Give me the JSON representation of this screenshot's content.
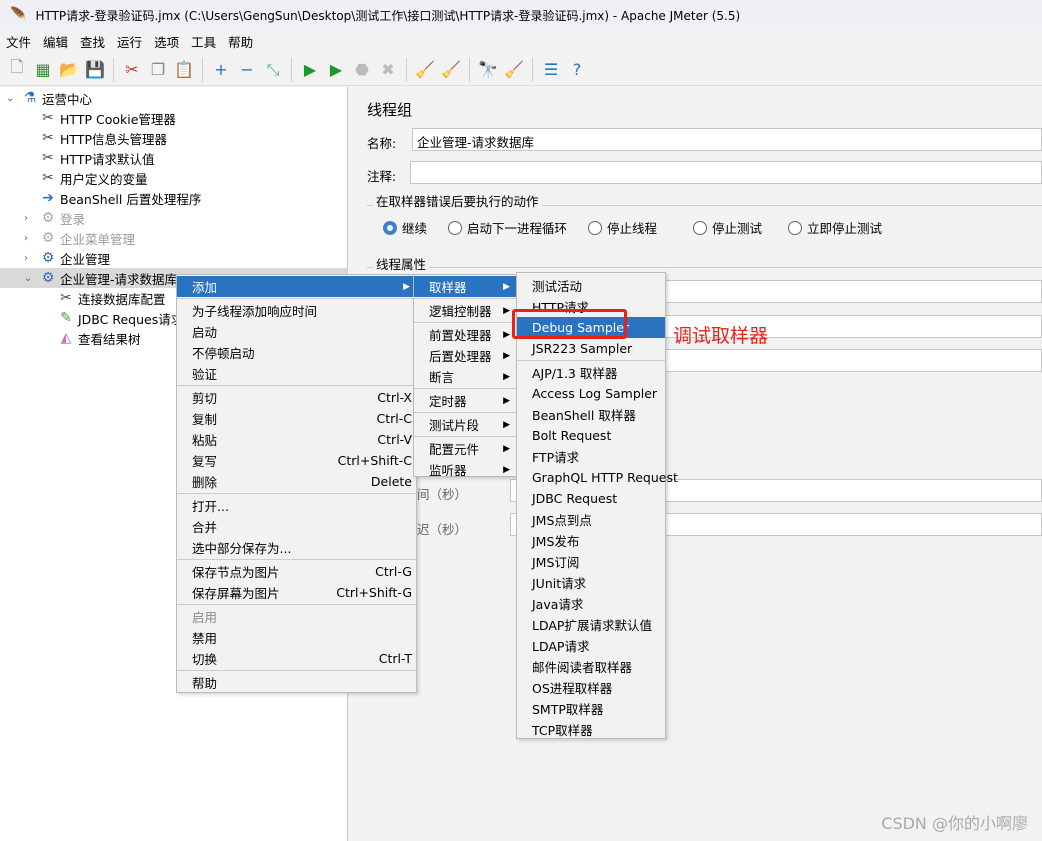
{
  "window": {
    "title": "HTTP请求-登录验证码.jmx (C:\\Users\\GengSun\\Desktop\\测试工作\\接口测试\\HTTP请求-登录验证码.jmx) - Apache JMeter (5.5)"
  },
  "menubar": [
    "文件",
    "编辑",
    "查找",
    "运行",
    "选项",
    "工具",
    "帮助"
  ],
  "toolbar": [
    {
      "icon": "new-icon",
      "g": "🗋",
      "c": "#888"
    },
    {
      "icon": "templates-icon",
      "g": "▦",
      "c": "#3a8e3a"
    },
    {
      "icon": "open-icon",
      "g": "📂",
      "c": "#d9a030"
    },
    {
      "icon": "save-icon",
      "g": "💾",
      "c": "#333"
    },
    {
      "sep": true
    },
    {
      "icon": "cut-icon",
      "g": "✂",
      "c": "#c0392b"
    },
    {
      "icon": "copy-icon",
      "g": "❐",
      "c": "#888"
    },
    {
      "icon": "paste-icon",
      "g": "📋",
      "c": "#8a5a2b"
    },
    {
      "sep": true
    },
    {
      "icon": "expand-icon",
      "g": "+",
      "c": "#2a73c0"
    },
    {
      "icon": "collapse-icon",
      "g": "−",
      "c": "#2a73c0"
    },
    {
      "icon": "toggle-icon",
      "g": "⤡",
      "c": "#5a9"
    },
    {
      "sep": true
    },
    {
      "icon": "start-icon",
      "g": "▶",
      "c": "#1a9a2a"
    },
    {
      "icon": "start-no-pause-icon",
      "g": "▶",
      "c": "#1a9a2a"
    },
    {
      "icon": "stop-icon",
      "g": "⬣",
      "c": "#bbb"
    },
    {
      "icon": "shutdown-icon",
      "g": "✖",
      "c": "#bbb"
    },
    {
      "sep": true
    },
    {
      "icon": "clear-icon",
      "g": "🧹",
      "c": "#8a6a3a"
    },
    {
      "icon": "clear-all-icon",
      "g": "🧹",
      "c": "#8a6a3a"
    },
    {
      "sep": true
    },
    {
      "icon": "search-icon",
      "g": "🔭",
      "c": "#222"
    },
    {
      "icon": "reset-search-icon",
      "g": "🧹",
      "c": "#d9b020"
    },
    {
      "sep": true
    },
    {
      "icon": "function-helper-icon",
      "g": "☰",
      "c": "#2a73c0"
    },
    {
      "icon": "help-icon",
      "g": "?",
      "c": "#2a73c0"
    }
  ],
  "tree": [
    {
      "label": "运营中心",
      "icon": "test-plan-icon",
      "g": "⚗",
      "c": "#2a73c0",
      "indent": 0,
      "arrow": "⌄"
    },
    {
      "label": "HTTP Cookie管理器",
      "icon": "config-tools-icon",
      "g": "✂",
      "c": "#444",
      "indent": 1
    },
    {
      "label": "HTTP信息头管理器",
      "icon": "config-tools-icon",
      "g": "✂",
      "c": "#444",
      "indent": 1
    },
    {
      "label": "HTTP请求默认值",
      "icon": "config-tools-icon",
      "g": "✂",
      "c": "#444",
      "indent": 1
    },
    {
      "label": "用户定义的变量",
      "icon": "config-tools-icon",
      "g": "✂",
      "c": "#444",
      "indent": 1
    },
    {
      "label": "BeanShell 后置处理程序",
      "icon": "post-processor-icon",
      "g": "➔",
      "c": "#2a73c0",
      "indent": 1
    },
    {
      "label": "登录",
      "icon": "thread-group-icon",
      "g": "⚙",
      "c": "#aaa",
      "indent": 1,
      "arrow": "›",
      "disabled": true
    },
    {
      "label": "企业菜单管理",
      "icon": "thread-group-icon",
      "g": "⚙",
      "c": "#aaa",
      "indent": 1,
      "arrow": "›",
      "disabled": true
    },
    {
      "label": "企业管理",
      "icon": "thread-group-icon",
      "g": "⚙",
      "c": "#3a6ab0",
      "indent": 1,
      "arrow": "›"
    },
    {
      "label": "企业管理-请求数据库",
      "icon": "thread-group-icon",
      "g": "⚙",
      "c": "#3a6ab0",
      "indent": 1,
      "arrow": "⌄",
      "selected": true
    },
    {
      "label": "连接数据库配置",
      "icon": "config-tools-icon",
      "g": "✂",
      "c": "#444",
      "indent": 2
    },
    {
      "label": "JDBC Reques请求",
      "icon": "sampler-pipette-icon",
      "g": "✎",
      "c": "#4a9a3a",
      "indent": 2
    },
    {
      "label": "查看结果树",
      "icon": "listener-chart-icon",
      "g": "◭",
      "c": "#d070c0",
      "indent": 2
    }
  ],
  "panel": {
    "title": "线程组",
    "name_label": "名称:",
    "name_value": "企业管理-请求数据库",
    "comment_label": "注释:",
    "comment_value": "",
    "error_action_title": "在取样器错误后要执行的动作",
    "error_actions": [
      {
        "label": "继续",
        "checked": true
      },
      {
        "label": "启动下一进程循环",
        "checked": false
      },
      {
        "label": "停止线程",
        "checked": false
      },
      {
        "label": "停止测试",
        "checked": false
      },
      {
        "label": "立即停止测试",
        "checked": false
      }
    ],
    "thread_props_title": "线程属性",
    "partial_label_1": "间（秒）",
    "partial_label_2": "迟（秒）"
  },
  "context_menu": [
    {
      "label": "添加",
      "submenu": true,
      "highlight": true
    },
    {
      "sep": true
    },
    {
      "label": "为子线程添加响应时间"
    },
    {
      "label": "启动"
    },
    {
      "label": "不停顿启动"
    },
    {
      "label": "验证"
    },
    {
      "sep": true
    },
    {
      "label": "剪切",
      "shortcut": "Ctrl-X"
    },
    {
      "label": "复制",
      "shortcut": "Ctrl-C"
    },
    {
      "label": "粘贴",
      "shortcut": "Ctrl-V"
    },
    {
      "label": "复写",
      "shortcut": "Ctrl+Shift-C"
    },
    {
      "label": "删除",
      "shortcut": "Delete"
    },
    {
      "sep": true
    },
    {
      "label": "打开..."
    },
    {
      "label": "合并"
    },
    {
      "label": "选中部分保存为..."
    },
    {
      "sep": true
    },
    {
      "label": "保存节点为图片",
      "shortcut": "Ctrl-G"
    },
    {
      "label": "保存屏幕为图片",
      "shortcut": "Ctrl+Shift-G"
    },
    {
      "sep": true
    },
    {
      "label": "启用",
      "disabled": true
    },
    {
      "label": "禁用"
    },
    {
      "label": "切换",
      "shortcut": "Ctrl-T"
    },
    {
      "sep": true
    },
    {
      "label": "帮助"
    }
  ],
  "add_menu": [
    {
      "label": "取样器",
      "submenu": true,
      "highlight": true
    },
    {
      "sep": true
    },
    {
      "label": "逻辑控制器",
      "submenu": true
    },
    {
      "sep": true
    },
    {
      "label": "前置处理器",
      "submenu": true
    },
    {
      "label": "后置处理器",
      "submenu": true
    },
    {
      "label": "断言",
      "submenu": true
    },
    {
      "sep": true
    },
    {
      "label": "定时器",
      "submenu": true
    },
    {
      "sep": true
    },
    {
      "label": "测试片段",
      "submenu": true
    },
    {
      "sep": true
    },
    {
      "label": "配置元件",
      "submenu": true
    },
    {
      "label": "监听器",
      "submenu": true
    }
  ],
  "sampler_menu": [
    {
      "label": "测试活动"
    },
    {
      "label": "HTTP请求"
    },
    {
      "label": "Debug Sampler",
      "highlight": true
    },
    {
      "label": "JSR223 Sampler"
    },
    {
      "sep": true
    },
    {
      "label": "AJP/1.3 取样器"
    },
    {
      "label": "Access Log Sampler"
    },
    {
      "label": "BeanShell 取样器"
    },
    {
      "label": "Bolt Request"
    },
    {
      "label": "FTP请求"
    },
    {
      "label": "GraphQL HTTP Request"
    },
    {
      "label": "JDBC Request"
    },
    {
      "label": "JMS点到点"
    },
    {
      "label": "JMS发布"
    },
    {
      "label": "JMS订阅"
    },
    {
      "label": "JUnit请求"
    },
    {
      "label": "Java请求"
    },
    {
      "label": "LDAP扩展请求默认值"
    },
    {
      "label": "LDAP请求"
    },
    {
      "label": "邮件阅读者取样器"
    },
    {
      "label": "OS进程取样器"
    },
    {
      "label": "SMTP取样器"
    },
    {
      "label": "TCP取样器"
    }
  ],
  "annotation": "调试取样器",
  "watermark": "CSDN @你的小啊廖",
  "colors": {
    "highlight": "#2a73c0",
    "annotation": "#e8221b"
  }
}
